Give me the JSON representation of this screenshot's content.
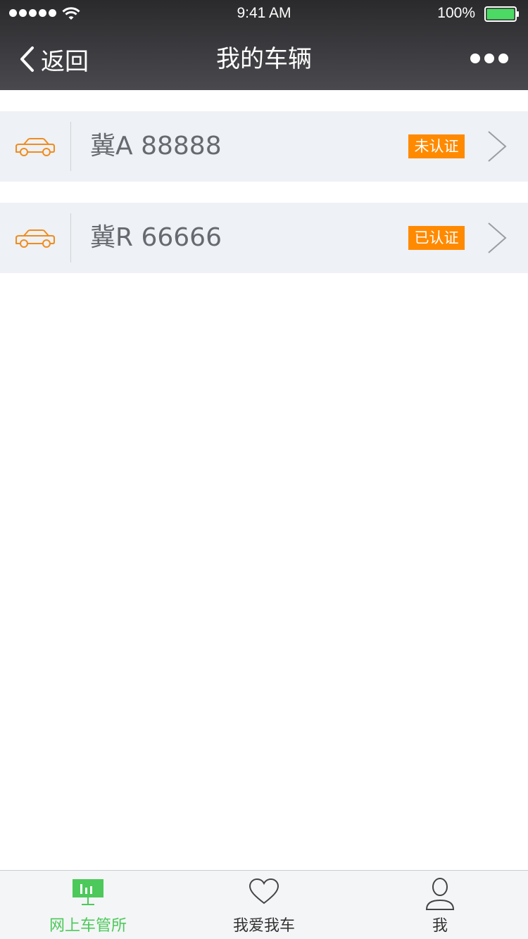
{
  "status_bar": {
    "time": "9:41 AM",
    "battery": "100%",
    "icons": [
      "signal-dots-icon",
      "wifi-icon",
      "battery-icon"
    ]
  },
  "nav": {
    "back_label": "返回",
    "title": "我的车辆",
    "icons": [
      "chevron-left-icon",
      "more-dots-icon"
    ]
  },
  "vehicles": [
    {
      "plate": "冀A 88888",
      "status": "未认证",
      "icon": "car-icon"
    },
    {
      "plate": "冀R 66666",
      "status": "已认证",
      "icon": "car-icon"
    }
  ],
  "tabs": [
    {
      "label": "网上车管所",
      "icon": "chart-board-icon",
      "active": true
    },
    {
      "label": "我爱我车",
      "icon": "heart-icon",
      "active": false
    },
    {
      "label": "我",
      "icon": "person-icon",
      "active": false
    }
  ],
  "colors": {
    "header_bg": "#3a3a3e",
    "badge_bg": "#ff8a00",
    "accent_icon": "#f08c1e",
    "active_tab": "#4cc95a",
    "item_bg": "#eef1f5"
  }
}
